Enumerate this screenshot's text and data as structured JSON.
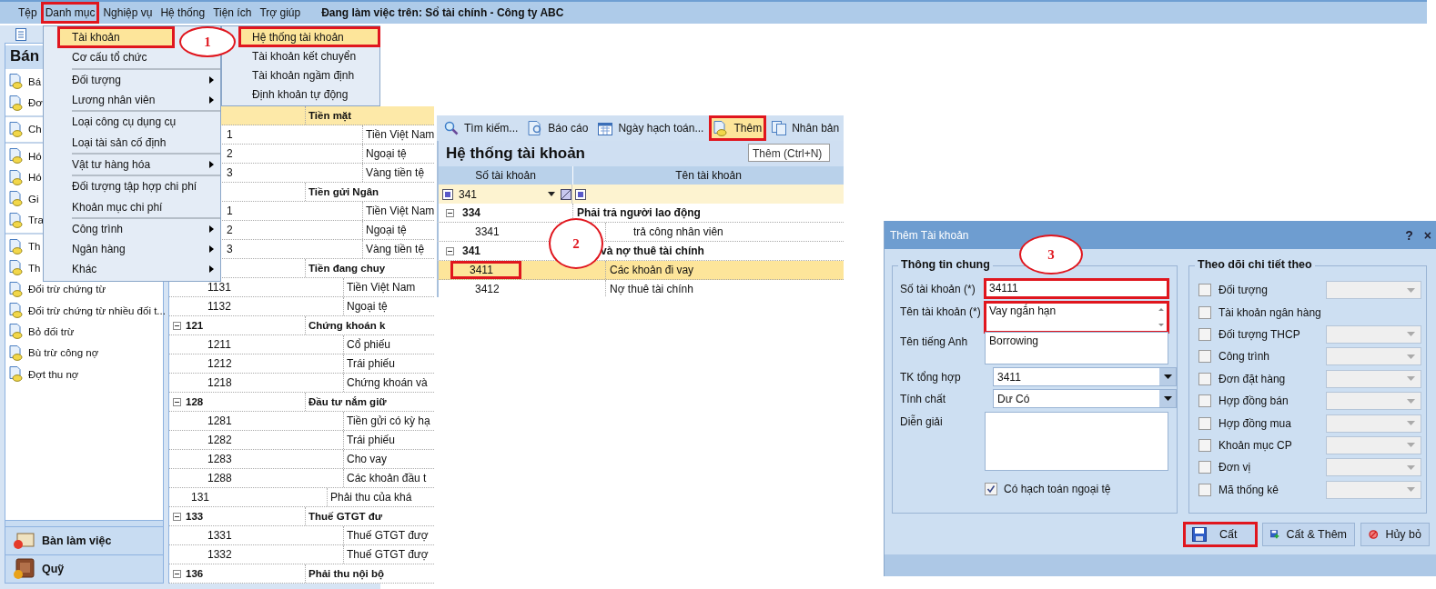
{
  "menubar": {
    "items": [
      {
        "label": "Tệp",
        "marked": false
      },
      {
        "label": "Danh mục",
        "marked": true
      },
      {
        "label": "Nghiệp vụ",
        "marked": false
      },
      {
        "label": "Hệ thống",
        "marked": false
      },
      {
        "label": "Tiện ích",
        "marked": false
      },
      {
        "label": "Trợ giúp",
        "marked": false
      }
    ],
    "status": "Đang làm việc trên: Sổ tài chính - Công ty ABC"
  },
  "sidebar": {
    "title": "Bán",
    "groups": [
      [
        {
          "label": "Bá"
        },
        {
          "label": "Đơ"
        }
      ],
      [
        {
          "label": "Ch"
        }
      ],
      [
        {
          "label": "Hó"
        },
        {
          "label": "Hó"
        },
        {
          "label": "Gi"
        },
        {
          "label": "Tra"
        }
      ],
      [
        {
          "label": "Th"
        },
        {
          "label": "Th"
        },
        {
          "label": "Đối trừ chứng từ"
        },
        {
          "label": "Đối trừ chứng từ nhiều đối t..."
        },
        {
          "label": "Bỏ đối trừ"
        },
        {
          "label": "Bù trừ công nợ"
        },
        {
          "label": "Đợt thu nợ"
        }
      ]
    ],
    "bottom": [
      {
        "label": "Bàn làm việc"
      },
      {
        "label": "Quỹ"
      }
    ]
  },
  "grid": {
    "rows": [
      {
        "kind": "grouptail",
        "selected": true,
        "name": "Tiền mặt"
      },
      {
        "kind": "childtail",
        "selected": false,
        "code": "1",
        "name": "Tiền Việt Nam"
      },
      {
        "kind": "childtail",
        "selected": false,
        "code": "2",
        "name": "Ngoại tệ"
      },
      {
        "kind": "childtail",
        "selected": false,
        "code": "3",
        "name": "Vàng tiền tệ"
      },
      {
        "kind": "grouptail",
        "selected": false,
        "name": "Tiền gửi Ngân"
      },
      {
        "kind": "childtail",
        "selected": false,
        "code": "1",
        "name": "Tiền Việt Nam"
      },
      {
        "kind": "childtail",
        "selected": false,
        "code": "2",
        "name": "Ngoại tệ"
      },
      {
        "kind": "childtail",
        "selected": false,
        "code": "3",
        "name": "Vàng tiền tệ"
      },
      {
        "kind": "grouptail",
        "selected": false,
        "name": "Tiền đang chuy"
      },
      {
        "kind": "child",
        "selected": false,
        "code": "1131",
        "name": "Tiền Việt Nam"
      },
      {
        "kind": "child",
        "selected": false,
        "code": "1132",
        "name": "Ngoại tệ"
      },
      {
        "kind": "group",
        "selected": false,
        "code": "121",
        "name": "Chứng khoán k"
      },
      {
        "kind": "child",
        "selected": false,
        "code": "1211",
        "name": "Cổ phiếu"
      },
      {
        "kind": "child",
        "selected": false,
        "code": "1212",
        "name": "Trái phiếu"
      },
      {
        "kind": "child",
        "selected": false,
        "code": "1218",
        "name": "Chứng khoán và"
      },
      {
        "kind": "group",
        "selected": false,
        "code": "128",
        "name": "Đầu tư nắm giữ"
      },
      {
        "kind": "child",
        "selected": false,
        "code": "1281",
        "name": "Tiền gửi có kỳ hạ"
      },
      {
        "kind": "child",
        "selected": false,
        "code": "1282",
        "name": "Trái phiếu"
      },
      {
        "kind": "child",
        "selected": false,
        "code": "1283",
        "name": "Cho vay"
      },
      {
        "kind": "child",
        "selected": false,
        "code": "1288",
        "name": "Các khoản đầu t"
      },
      {
        "kind": "leaf",
        "selected": false,
        "code": "131",
        "name": "Phải thu của khá"
      },
      {
        "kind": "group",
        "selected": false,
        "code": "133",
        "name": "Thuế GTGT đư"
      },
      {
        "kind": "child",
        "selected": false,
        "code": "1331",
        "name": "Thuế GTGT đượ"
      },
      {
        "kind": "child",
        "selected": false,
        "code": "1332",
        "name": "Thuế GTGT đượ"
      },
      {
        "kind": "group",
        "selected": false,
        "code": "136",
        "name": "Phải thu nội bộ"
      }
    ]
  },
  "menu": {
    "groups": [
      [
        {
          "label": "Tài khoản",
          "selected": true,
          "marked": true,
          "has_submenu": false
        },
        {
          "label": "Cơ cấu tổ chức",
          "selected": false,
          "marked": false,
          "has_submenu": false
        }
      ],
      [
        {
          "label": "Đối tượng",
          "selected": false,
          "marked": false,
          "has_submenu": true
        },
        {
          "label": "Lương nhân viên",
          "selected": false,
          "marked": false,
          "has_submenu": true
        }
      ],
      [
        {
          "label": "Loại công cụ dụng cụ",
          "selected": false,
          "marked": false,
          "has_submenu": false
        },
        {
          "label": "Loại tài sản cố định",
          "selected": false,
          "marked": false,
          "has_submenu": false
        }
      ],
      [
        {
          "label": "Vật tư hàng hóa",
          "selected": false,
          "marked": false,
          "has_submenu": true
        }
      ],
      [
        {
          "label": "Đối tượng tập hợp chi phí",
          "selected": false,
          "marked": false,
          "has_submenu": false
        },
        {
          "label": "Khoản mục chi phí",
          "selected": false,
          "marked": false,
          "has_submenu": false
        }
      ],
      [
        {
          "label": "Công trình",
          "selected": false,
          "marked": false,
          "has_submenu": true
        },
        {
          "label": "Ngân hàng",
          "selected": false,
          "marked": false,
          "has_submenu": true
        },
        {
          "label": "Khác",
          "selected": false,
          "marked": false,
          "has_submenu": true
        }
      ]
    ],
    "submenu": [
      {
        "label": "Hệ thống tài khoản",
        "selected": true,
        "marked": true
      },
      {
        "label": "Tài khoản kết chuyển",
        "selected": false,
        "marked": false
      },
      {
        "label": "Tài khoản ngầm định",
        "selected": false,
        "marked": false
      },
      {
        "label": "Định khoản tự động",
        "selected": false,
        "marked": false
      }
    ]
  },
  "accounts": {
    "toolbar": [
      {
        "label": "Tìm kiếm...",
        "marked": false
      },
      {
        "label": "Báo cáo",
        "marked": false
      },
      {
        "label": "Ngày hạch toán...",
        "marked": false
      },
      {
        "label": "Thêm",
        "marked": true
      },
      {
        "label": "Nhân bản",
        "marked": false
      }
    ],
    "title": "Hệ thống tài khoản",
    "tooltip": "Thêm (Ctrl+N)",
    "columns": [
      "Số tài khoản",
      "Tên tài khoản"
    ],
    "filter": "341",
    "rows": [
      {
        "kind": "group",
        "code": "334",
        "name": "Phải trả người lao động",
        "selected": false,
        "marked": false
      },
      {
        "kind": "childtail",
        "code": "3341",
        "name": "trả công nhân viên",
        "selected": false,
        "marked": false
      },
      {
        "kind": "grouptail",
        "code": "341",
        "name": "và nợ thuê tài chính",
        "selected": false,
        "marked": false
      },
      {
        "kind": "child",
        "code": "3411",
        "name": "Các khoản đi vay",
        "selected": true,
        "marked": true
      },
      {
        "kind": "child",
        "code": "3412",
        "name": "Nợ thuê tài chính",
        "selected": false,
        "marked": false
      }
    ]
  },
  "dialog": {
    "title": "Thêm Tài khoản",
    "help": "?",
    "close": "×",
    "general": {
      "legend": "Thông tin chung",
      "fields": [
        {
          "kind": "text",
          "label": "Số tài khoản (*)",
          "value": "34111",
          "marked": true
        },
        {
          "kind": "textarea",
          "label": "Tên tài khoản (*)",
          "value": "Vay ngắn hạn",
          "marked": true
        },
        {
          "kind": "textarea",
          "label": "Tên tiếng Anh",
          "value": "Borrowing",
          "marked": false
        },
        {
          "kind": "combo",
          "label": "TK tổng hợp",
          "value": "3411",
          "marked": false
        },
        {
          "kind": "combo",
          "label": "Tính chất",
          "value": "Dư Có",
          "marked": false
        },
        {
          "kind": "memo",
          "label": "Diễn giải",
          "marked": false
        }
      ],
      "foreign_currency": {
        "label": "Có hạch toán ngoại tệ",
        "checked": true
      }
    },
    "tracking": {
      "legend": "Theo dõi chi tiết theo",
      "items": [
        {
          "label": "Đối tượng",
          "checked": false,
          "has_combo": true
        },
        {
          "label": "Tài khoản ngân hàng",
          "checked": false,
          "has_combo": false
        },
        {
          "label": "Đối tượng THCP",
          "checked": false,
          "has_combo": true
        },
        {
          "label": "Công trình",
          "checked": false,
          "has_combo": true
        },
        {
          "label": "Đơn đặt hàng",
          "checked": false,
          "has_combo": true
        },
        {
          "label": "Hợp đồng bán",
          "checked": false,
          "has_combo": true
        },
        {
          "label": "Hợp đồng mua",
          "checked": false,
          "has_combo": true
        },
        {
          "label": "Khoản mục CP",
          "checked": false,
          "has_combo": true
        },
        {
          "label": "Đơn vị",
          "checked": false,
          "has_combo": true
        },
        {
          "label": "Mã thống kê",
          "checked": false,
          "has_combo": true
        }
      ]
    },
    "buttons": [
      {
        "label": "Cất",
        "marked": true
      },
      {
        "label": "Cất & Thêm",
        "marked": false
      },
      {
        "label": "Hủy bỏ",
        "marked": false
      }
    ]
  },
  "callouts": [
    {
      "label": "1"
    },
    {
      "label": "2"
    },
    {
      "label": "3"
    }
  ]
}
